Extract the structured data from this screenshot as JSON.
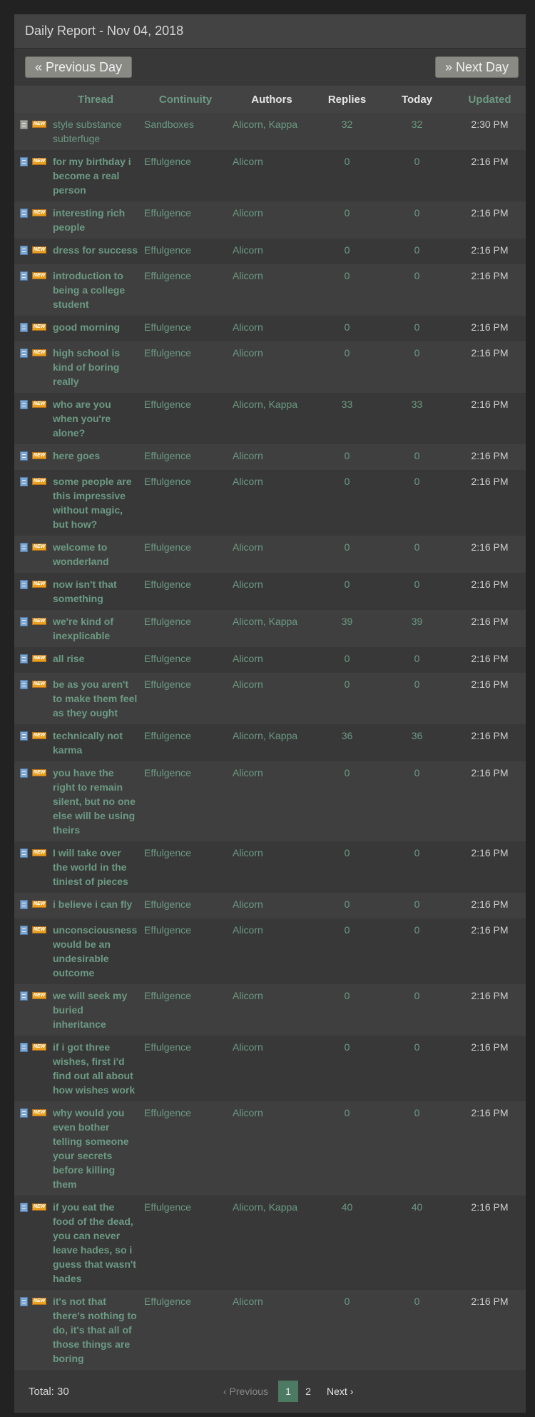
{
  "header": {
    "title": "Daily Report - Nov 04, 2018"
  },
  "nav": {
    "prev_label": "« Previous Day",
    "next_label": "» Next Day"
  },
  "columns": {
    "thread": "Thread",
    "continuity": "Continuity",
    "authors": "Authors",
    "replies": "Replies",
    "today": "Today",
    "updated": "Updated"
  },
  "rows": [
    {
      "thread": "style substance subterfuge",
      "continuity": "Sandboxes",
      "authors": "Alicorn, Kappa",
      "replies": "32",
      "today": "32",
      "updated": "2:30 PM"
    },
    {
      "thread": "for my birthday i become a real person",
      "continuity": "Effulgence",
      "authors": "Alicorn",
      "replies": "0",
      "today": "0",
      "updated": "2:16 PM"
    },
    {
      "thread": "interesting rich people",
      "continuity": "Effulgence",
      "authors": "Alicorn",
      "replies": "0",
      "today": "0",
      "updated": "2:16 PM"
    },
    {
      "thread": "dress for success",
      "continuity": "Effulgence",
      "authors": "Alicorn",
      "replies": "0",
      "today": "0",
      "updated": "2:16 PM"
    },
    {
      "thread": "introduction to being a college student",
      "continuity": "Effulgence",
      "authors": "Alicorn",
      "replies": "0",
      "today": "0",
      "updated": "2:16 PM"
    },
    {
      "thread": "good morning",
      "continuity": "Effulgence",
      "authors": "Alicorn",
      "replies": "0",
      "today": "0",
      "updated": "2:16 PM"
    },
    {
      "thread": "high school is kind of boring really",
      "continuity": "Effulgence",
      "authors": "Alicorn",
      "replies": "0",
      "today": "0",
      "updated": "2:16 PM"
    },
    {
      "thread": "who are you when you're alone?",
      "continuity": "Effulgence",
      "authors": "Alicorn, Kappa",
      "replies": "33",
      "today": "33",
      "updated": "2:16 PM"
    },
    {
      "thread": "here goes",
      "continuity": "Effulgence",
      "authors": "Alicorn",
      "replies": "0",
      "today": "0",
      "updated": "2:16 PM"
    },
    {
      "thread": "some people are this impressive without magic, but how?",
      "continuity": "Effulgence",
      "authors": "Alicorn",
      "replies": "0",
      "today": "0",
      "updated": "2:16 PM"
    },
    {
      "thread": "welcome to wonderland",
      "continuity": "Effulgence",
      "authors": "Alicorn",
      "replies": "0",
      "today": "0",
      "updated": "2:16 PM"
    },
    {
      "thread": "now isn't that something",
      "continuity": "Effulgence",
      "authors": "Alicorn",
      "replies": "0",
      "today": "0",
      "updated": "2:16 PM"
    },
    {
      "thread": "we're kind of inexplicable",
      "continuity": "Effulgence",
      "authors": "Alicorn, Kappa",
      "replies": "39",
      "today": "39",
      "updated": "2:16 PM"
    },
    {
      "thread": "all rise",
      "continuity": "Effulgence",
      "authors": "Alicorn",
      "replies": "0",
      "today": "0",
      "updated": "2:16 PM"
    },
    {
      "thread": "be as you aren't to make them feel as they ought",
      "continuity": "Effulgence",
      "authors": "Alicorn",
      "replies": "0",
      "today": "0",
      "updated": "2:16 PM"
    },
    {
      "thread": "technically not karma",
      "continuity": "Effulgence",
      "authors": "Alicorn, Kappa",
      "replies": "36",
      "today": "36",
      "updated": "2:16 PM"
    },
    {
      "thread": "you have the right to remain silent, but no one else will be using theirs",
      "continuity": "Effulgence",
      "authors": "Alicorn",
      "replies": "0",
      "today": "0",
      "updated": "2:16 PM"
    },
    {
      "thread": "I will take over the world in the tiniest of pieces",
      "continuity": "Effulgence",
      "authors": "Alicorn",
      "replies": "0",
      "today": "0",
      "updated": "2:16 PM"
    },
    {
      "thread": "i believe i can fly",
      "continuity": "Effulgence",
      "authors": "Alicorn",
      "replies": "0",
      "today": "0",
      "updated": "2:16 PM"
    },
    {
      "thread": "unconsciousness would be an undesirable outcome",
      "continuity": "Effulgence",
      "authors": "Alicorn",
      "replies": "0",
      "today": "0",
      "updated": "2:16 PM"
    },
    {
      "thread": "we will seek my buried inheritance",
      "continuity": "Effulgence",
      "authors": "Alicorn",
      "replies": "0",
      "today": "0",
      "updated": "2:16 PM"
    },
    {
      "thread": "if i got three wishes, first i'd find out all about how wishes work",
      "continuity": "Effulgence",
      "authors": "Alicorn",
      "replies": "0",
      "today": "0",
      "updated": "2:16 PM"
    },
    {
      "thread": "why would you even bother telling someone your secrets before killing them",
      "continuity": "Effulgence",
      "authors": "Alicorn",
      "replies": "0",
      "today": "0",
      "updated": "2:16 PM"
    },
    {
      "thread": "if you eat the food of the dead, you can never leave hades, so i guess that wasn't hades",
      "continuity": "Effulgence",
      "authors": "Alicorn, Kappa",
      "replies": "40",
      "today": "40",
      "updated": "2:16 PM"
    },
    {
      "thread": "it's not that there's nothing to do, it's that all of those things are boring",
      "continuity": "Effulgence",
      "authors": "Alicorn",
      "replies": "0",
      "today": "0",
      "updated": "2:16 PM"
    }
  ],
  "footer": {
    "total": "Total: 30",
    "prev": "‹ Previous",
    "pages": [
      "1",
      "2"
    ],
    "next": "Next ›"
  },
  "icons": {
    "unread": "document-icon",
    "new": "new-badge-icon"
  },
  "colors": {
    "link": "#6c9a83",
    "active_page": "#4d7a63"
  }
}
